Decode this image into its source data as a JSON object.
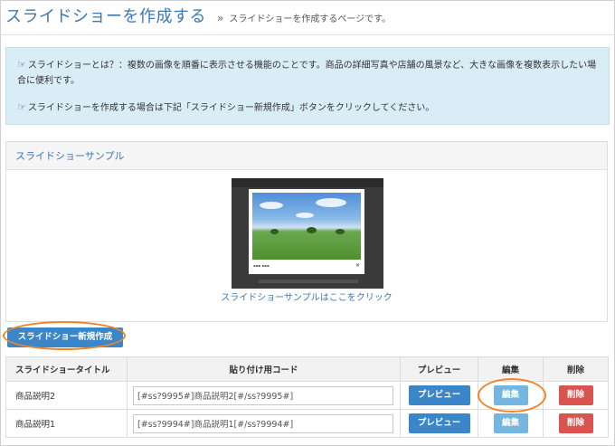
{
  "header": {
    "title": "スライドショーを作成する",
    "separator": "»",
    "subtitle": "スライドショーを作成するページです。"
  },
  "info": {
    "line1": "スライドショーとは？：複数の画像を順番に表示させる機能のことです。商品の詳細写真や店舗の風景など、大きな画像を複数表示したい場合に便利です。",
    "line2": "スライドショーを作成する場合は下記「スライドショー新規作成」ボタンをクリックしてください。",
    "icon": "hand-point-right-icon"
  },
  "sample_panel": {
    "heading": "スライドショーサンプル",
    "link_text": "スライドショーサンプルはここをクリック"
  },
  "new_button_label": "スライドショー新規作成",
  "table": {
    "headers": [
      "スライドショータイトル",
      "貼り付け用コード",
      "プレビュー",
      "編集",
      "削除"
    ],
    "rows": [
      {
        "title": "商品説明2",
        "code": "[#ss?9995#]商品説明2[#/ss?9995#]",
        "preview": "プレビュー",
        "edit": "編集",
        "delete": "削除"
      },
      {
        "title": "商品説明1",
        "code": "[#ss?9994#]商品説明1[#/ss?9994#]",
        "preview": "プレビュー",
        "edit": "編集",
        "delete": "削除"
      }
    ]
  },
  "colors": {
    "accent": "#3a78b7",
    "primary_button": "#3a86c8",
    "edit_button": "#74b6e0",
    "delete_button": "#d9534f",
    "highlight_ring": "#f0852a",
    "info_background": "#d9edf7"
  }
}
